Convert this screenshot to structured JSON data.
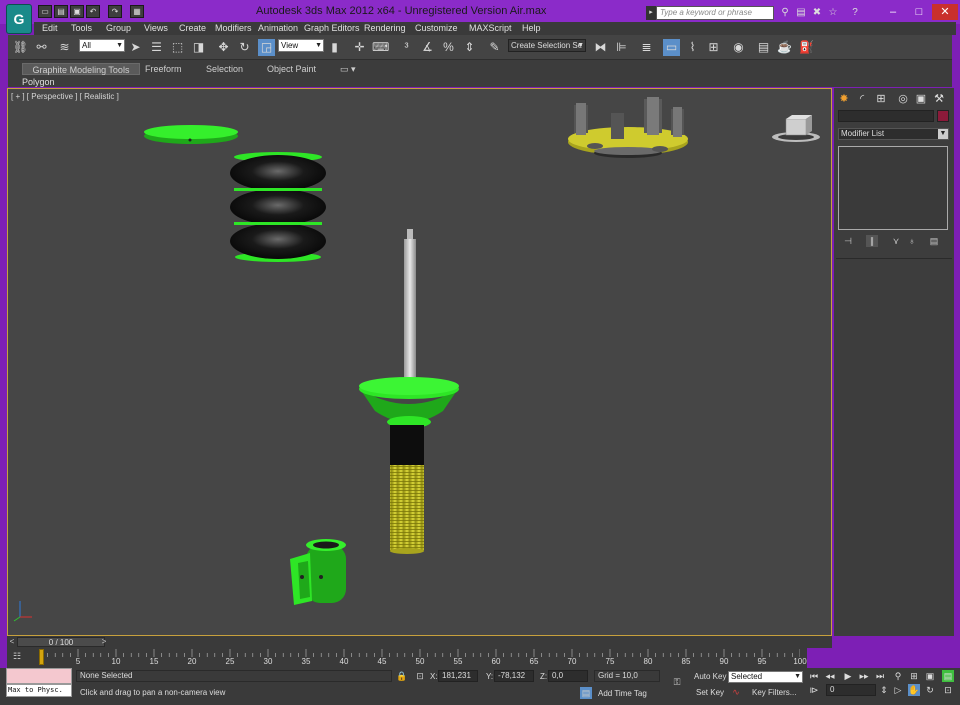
{
  "window": {
    "title": "Autodesk 3ds Max  2012 x64  - Unregistered Version      Air.max",
    "search_placeholder": "Type a keyword or phrase",
    "buttons": {
      "minimize": "–",
      "maximize": "□",
      "close": "✕"
    }
  },
  "menus": [
    "Edit",
    "Tools",
    "Group",
    "Views",
    "Create",
    "Modifiers",
    "Animation",
    "Graph Editors",
    "Rendering",
    "Customize",
    "MAXScript",
    "Help"
  ],
  "toolbar": {
    "selection_filter": "All",
    "reference_coord": "View",
    "named_selection_placeholder": "Create Selection Se"
  },
  "ribbon": {
    "tabs": [
      "Graphite Modeling Tools",
      "Freeform",
      "Selection",
      "Object Paint"
    ],
    "subtitle": "Polygon Modeling"
  },
  "viewport": {
    "label": "[ + ] [ Perspective ] [ Realistic ]"
  },
  "command_panel": {
    "modifier_list_label": "Modifier List"
  },
  "timeline": {
    "frame_display": "0 / 100",
    "ticks": [
      "5",
      "10",
      "15",
      "20",
      "25",
      "30",
      "35",
      "40",
      "45",
      "50",
      "55",
      "60",
      "65",
      "70",
      "75",
      "80",
      "85",
      "90",
      "95",
      "100"
    ]
  },
  "status": {
    "selection": "None Selected",
    "prompt": "Click and drag to pan a non-camera view",
    "maxscript": "Max to Physc.",
    "x_label": "X:",
    "x_value": "181,231",
    "y_label": "Y:",
    "y_value": "-78,132",
    "z_label": "Z:",
    "z_value": "0,0",
    "grid": "Grid = 10,0",
    "add_time_tag": "Add Time Tag",
    "auto_key": "Auto Key",
    "set_key": "Set Key",
    "key_mode": "Selected",
    "key_filters": "Key Filters...",
    "current_frame": "0"
  },
  "colors": {
    "title_bar": "#8b2bc9",
    "viewport_bg": "#464646",
    "viewport_border": "#c7a13d",
    "green_part": "#2ee626",
    "yellow_part": "#c8c42a"
  }
}
